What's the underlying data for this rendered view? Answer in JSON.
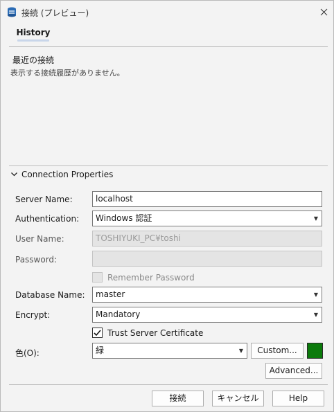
{
  "window": {
    "title": "接続 (プレビュー)"
  },
  "tabs": [
    {
      "label": "History"
    }
  ],
  "history": {
    "heading": "最近の接続",
    "empty_message": "表示する接続履歴がありません。"
  },
  "connection": {
    "section_label": "Connection Properties",
    "server_name": {
      "label": "Server Name:",
      "value": "localhost"
    },
    "authentication": {
      "label": "Authentication:",
      "value": "Windows 認証"
    },
    "user_name": {
      "label": "User Name:",
      "value": "TOSHIYUKI_PC¥toshi"
    },
    "password": {
      "label": "Password:",
      "value": ""
    },
    "remember_password": {
      "label": "Remember Password",
      "checked": false
    },
    "database_name": {
      "label": "Database Name:",
      "value": "master"
    },
    "encrypt": {
      "label": "Encrypt:",
      "value": "Mandatory"
    },
    "trust_server_certificate": {
      "label": "Trust Server Certificate",
      "checked": true
    },
    "color": {
      "label": "色(O):",
      "value": "緑",
      "swatch": "#0b7a0b"
    },
    "custom_button": "Custom...",
    "advanced_button": "Advanced..."
  },
  "footer": {
    "connect_button": "接続",
    "cancel_button": "キャンセル",
    "help_button": "Help"
  }
}
